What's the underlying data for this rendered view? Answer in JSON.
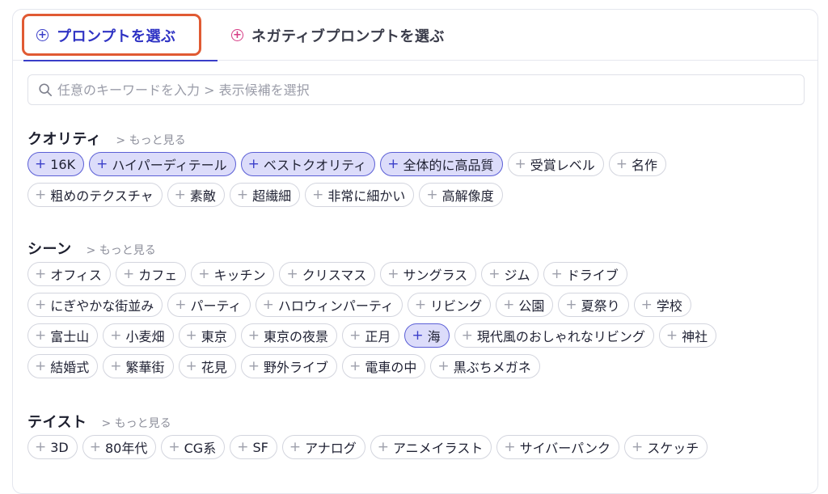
{
  "tabs": {
    "positive": {
      "icon": "add-circle-icon",
      "label": "プロンプトを選ぶ",
      "active": true
    },
    "negative": {
      "icon": "add-circle-icon",
      "label": "ネガティブプロンプトを選ぶ",
      "active": false
    }
  },
  "search": {
    "placeholder": "任意のキーワードを入力 > 表示候補を選択",
    "value": ""
  },
  "colors": {
    "accent": "#3a3ec9",
    "selected_chip_bg": "#dcdcfa",
    "negative_icon": "#d63b84",
    "highlight_box": "#e05a33"
  },
  "sections": [
    {
      "title": "クオリティ",
      "more": "> もっと見る",
      "rows": [
        [
          {
            "label": "16K",
            "selected": true
          },
          {
            "label": "ハイパーディテール",
            "selected": true
          },
          {
            "label": "ベストクオリティ",
            "selected": true
          },
          {
            "label": "全体的に高品質",
            "selected": true
          },
          {
            "label": "受賞レベル",
            "selected": false
          },
          {
            "label": "名作",
            "selected": false
          }
        ],
        [
          {
            "label": "粗めのテクスチャ",
            "selected": false
          },
          {
            "label": "素敵",
            "selected": false
          },
          {
            "label": "超繊細",
            "selected": false
          },
          {
            "label": "非常に細かい",
            "selected": false
          },
          {
            "label": "高解像度",
            "selected": false
          }
        ]
      ]
    },
    {
      "title": "シーン",
      "more": "> もっと見る",
      "rows": [
        [
          {
            "label": "オフィス",
            "selected": false
          },
          {
            "label": "カフェ",
            "selected": false
          },
          {
            "label": "キッチン",
            "selected": false
          },
          {
            "label": "クリスマス",
            "selected": false
          },
          {
            "label": "サングラス",
            "selected": false
          },
          {
            "label": "ジム",
            "selected": false
          },
          {
            "label": "ドライブ",
            "selected": false
          }
        ],
        [
          {
            "label": "にぎやかな街並み",
            "selected": false
          },
          {
            "label": "パーティ",
            "selected": false
          },
          {
            "label": "ハロウィンパーティ",
            "selected": false
          },
          {
            "label": "リビング",
            "selected": false
          },
          {
            "label": "公園",
            "selected": false
          },
          {
            "label": "夏祭り",
            "selected": false
          },
          {
            "label": "学校",
            "selected": false
          }
        ],
        [
          {
            "label": "富士山",
            "selected": false
          },
          {
            "label": "小麦畑",
            "selected": false
          },
          {
            "label": "東京",
            "selected": false
          },
          {
            "label": "東京の夜景",
            "selected": false
          },
          {
            "label": "正月",
            "selected": false
          },
          {
            "label": "海",
            "selected": true
          },
          {
            "label": "現代風のおしゃれなリビング",
            "selected": false
          },
          {
            "label": "神社",
            "selected": false
          }
        ],
        [
          {
            "label": "結婚式",
            "selected": false
          },
          {
            "label": "繁華街",
            "selected": false
          },
          {
            "label": "花見",
            "selected": false
          },
          {
            "label": "野外ライブ",
            "selected": false
          },
          {
            "label": "電車の中",
            "selected": false
          },
          {
            "label": "黒ぶちメガネ",
            "selected": false
          }
        ]
      ]
    },
    {
      "title": "テイスト",
      "more": "> もっと見る",
      "rows": [
        [
          {
            "label": "3D",
            "selected": false
          },
          {
            "label": "80年代",
            "selected": false
          },
          {
            "label": "CG系",
            "selected": false
          },
          {
            "label": "SF",
            "selected": false
          },
          {
            "label": "アナログ",
            "selected": false
          },
          {
            "label": "アニメイラスト",
            "selected": false
          },
          {
            "label": "サイバーパンク",
            "selected": false
          },
          {
            "label": "スケッチ",
            "selected": false
          }
        ]
      ]
    }
  ]
}
